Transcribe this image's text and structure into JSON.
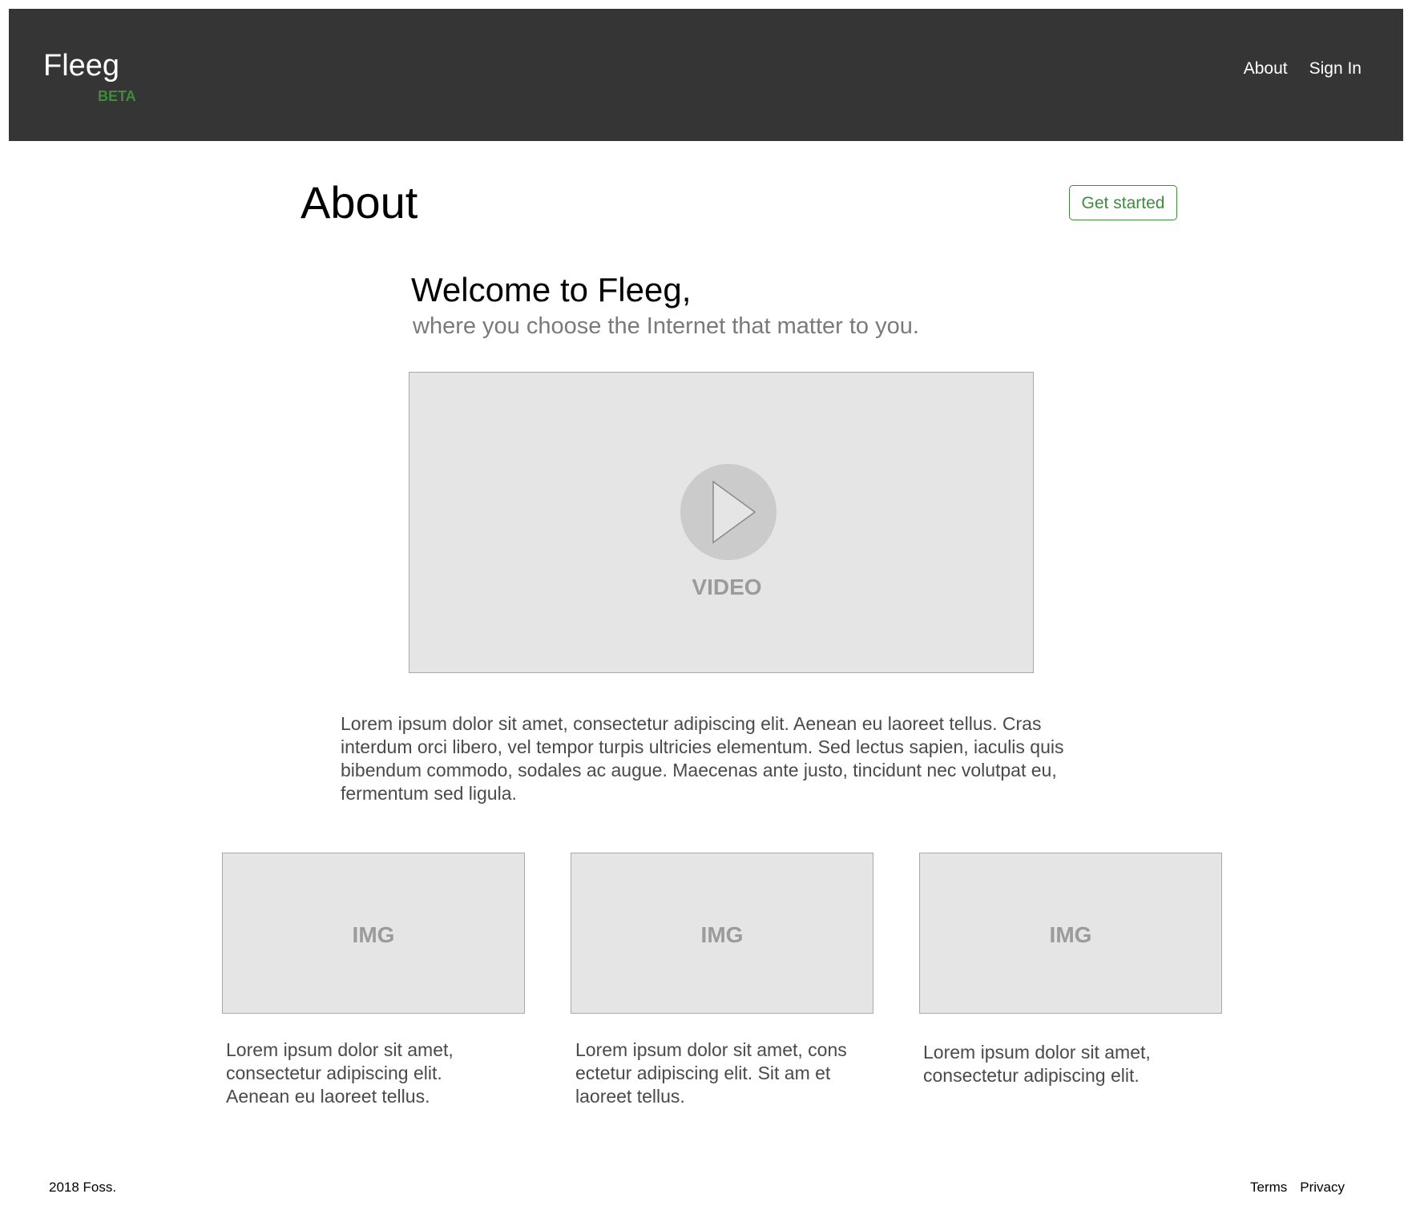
{
  "header": {
    "brand": "Fleeg",
    "badge": "BETA",
    "nav": [
      "About",
      "Sign In"
    ]
  },
  "main": {
    "title": "About",
    "cta_label": "Get started",
    "welcome_heading": "Welcome to Fleeg,",
    "tagline": "where you choose the Internet that matter to you.",
    "video_label": "VIDEO",
    "intro_text": "Lorem ipsum dolor sit amet, consectetur adipiscing elit. Aenean eu laoreet tellus. Cras interdum orci libero, vel tempor turpis ultricies elementum. Sed lectus sapien, iaculis quis bibendum commodo, sodales ac augue. Maecenas ante justo, tincidunt nec volutpat eu, fermentum sed ligula.",
    "cards": [
      {
        "image_label": "IMG",
        "text": "Lorem ipsum dolor sit amet, consectetur adipiscing elit. Aenean eu laoreet tellus."
      },
      {
        "image_label": "IMG",
        "text": "Lorem ipsum dolor sit amet, cons ectetur adipiscing elit. Sit am et laoreet tellus."
      },
      {
        "image_label": "IMG",
        "text": "Lorem ipsum dolor sit amet, consectetur adipiscing elit."
      }
    ]
  },
  "footer": {
    "copyright": "2018 Foss.",
    "links": [
      "Terms",
      "Privacy"
    ]
  },
  "colors": {
    "header_bg": "#353535",
    "accent_green": "#3e8b3e",
    "placeholder_bg": "#e5e5e5",
    "placeholder_text": "#9b9b9b",
    "body_text": "#4a4a4a",
    "tagline_text": "#7a7a7a"
  },
  "icons": {
    "video_play": "play-icon"
  }
}
